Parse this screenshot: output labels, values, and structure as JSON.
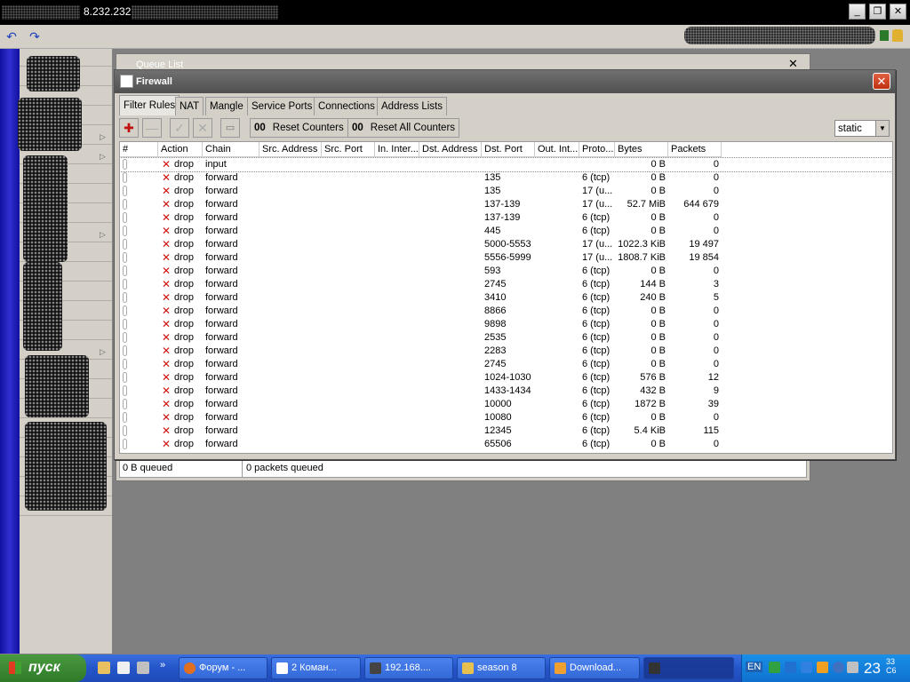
{
  "titlebar": {
    "ip": "8.232.232"
  },
  "queue_list": {
    "title": "Queue List",
    "status_bytes": "0 B queued",
    "status_packets": "0 packets queued"
  },
  "firewall": {
    "title": "Firewall",
    "tabs": [
      "Filter Rules",
      "NAT",
      "Mangle",
      "Service Ports",
      "Connections",
      "Address Lists"
    ],
    "active_tab": "Filter Rules",
    "reset_counters_label": "Reset Counters",
    "reset_all_counters_label": "Reset All Counters",
    "counter_glyph": "00",
    "filter_select_value": "static",
    "columns": [
      "#",
      "Action",
      "Chain",
      "Src. Address",
      "Src. Port",
      "In. Inter...",
      "Dst. Address",
      "Dst. Port",
      "Out. Int...",
      "Proto...",
      "Bytes",
      "Packets"
    ],
    "rows": [
      {
        "action": "drop",
        "chain": "input",
        "dst_port": "",
        "proto": "",
        "bytes": "0 B",
        "packets": "0"
      },
      {
        "action": "drop",
        "chain": "forward",
        "dst_port": "135",
        "proto": "6 (tcp)",
        "bytes": "0 B",
        "packets": "0"
      },
      {
        "action": "drop",
        "chain": "forward",
        "dst_port": "135",
        "proto": "17 (u...",
        "bytes": "0 B",
        "packets": "0"
      },
      {
        "action": "drop",
        "chain": "forward",
        "dst_port": "137-139",
        "proto": "17 (u...",
        "bytes": "52.7 MiB",
        "packets": "644 679"
      },
      {
        "action": "drop",
        "chain": "forward",
        "dst_port": "137-139",
        "proto": "6 (tcp)",
        "bytes": "0 B",
        "packets": "0"
      },
      {
        "action": "drop",
        "chain": "forward",
        "dst_port": "445",
        "proto": "6 (tcp)",
        "bytes": "0 B",
        "packets": "0"
      },
      {
        "action": "drop",
        "chain": "forward",
        "dst_port": "5000-5553",
        "proto": "17 (u...",
        "bytes": "1022.3 KiB",
        "packets": "19 497"
      },
      {
        "action": "drop",
        "chain": "forward",
        "dst_port": "5556-5999",
        "proto": "17 (u...",
        "bytes": "1808.7 KiB",
        "packets": "19 854"
      },
      {
        "action": "drop",
        "chain": "forward",
        "dst_port": "593",
        "proto": "6 (tcp)",
        "bytes": "0 B",
        "packets": "0"
      },
      {
        "action": "drop",
        "chain": "forward",
        "dst_port": "2745",
        "proto": "6 (tcp)",
        "bytes": "144 B",
        "packets": "3"
      },
      {
        "action": "drop",
        "chain": "forward",
        "dst_port": "3410",
        "proto": "6 (tcp)",
        "bytes": "240 B",
        "packets": "5"
      },
      {
        "action": "drop",
        "chain": "forward",
        "dst_port": "8866",
        "proto": "6 (tcp)",
        "bytes": "0 B",
        "packets": "0"
      },
      {
        "action": "drop",
        "chain": "forward",
        "dst_port": "9898",
        "proto": "6 (tcp)",
        "bytes": "0 B",
        "packets": "0"
      },
      {
        "action": "drop",
        "chain": "forward",
        "dst_port": "2535",
        "proto": "6 (tcp)",
        "bytes": "0 B",
        "packets": "0"
      },
      {
        "action": "drop",
        "chain": "forward",
        "dst_port": "2283",
        "proto": "6 (tcp)",
        "bytes": "0 B",
        "packets": "0"
      },
      {
        "action": "drop",
        "chain": "forward",
        "dst_port": "2745",
        "proto": "6 (tcp)",
        "bytes": "0 B",
        "packets": "0"
      },
      {
        "action": "drop",
        "chain": "forward",
        "dst_port": "1024-1030",
        "proto": "6 (tcp)",
        "bytes": "576 B",
        "packets": "12"
      },
      {
        "action": "drop",
        "chain": "forward",
        "dst_port": "1433-1434",
        "proto": "6 (tcp)",
        "bytes": "432 B",
        "packets": "9"
      },
      {
        "action": "drop",
        "chain": "forward",
        "dst_port": "10000",
        "proto": "6 (tcp)",
        "bytes": "1872 B",
        "packets": "39"
      },
      {
        "action": "drop",
        "chain": "forward",
        "dst_port": "10080",
        "proto": "6 (tcp)",
        "bytes": "0 B",
        "packets": "0"
      },
      {
        "action": "drop",
        "chain": "forward",
        "dst_port": "12345",
        "proto": "6 (tcp)",
        "bytes": "5.4 KiB",
        "packets": "115"
      },
      {
        "action": "drop",
        "chain": "forward",
        "dst_port": "65506",
        "proto": "6 (tcp)",
        "bytes": "0 B",
        "packets": "0"
      }
    ]
  },
  "taskbar": {
    "start_label": "пуск",
    "tasks": [
      "Форум - ...",
      "2 Коман...",
      "192.168....",
      "season 8",
      "Download..."
    ],
    "language": "EN",
    "clock": "23",
    "clock_minutes": "33",
    "clock_day": "C6"
  }
}
